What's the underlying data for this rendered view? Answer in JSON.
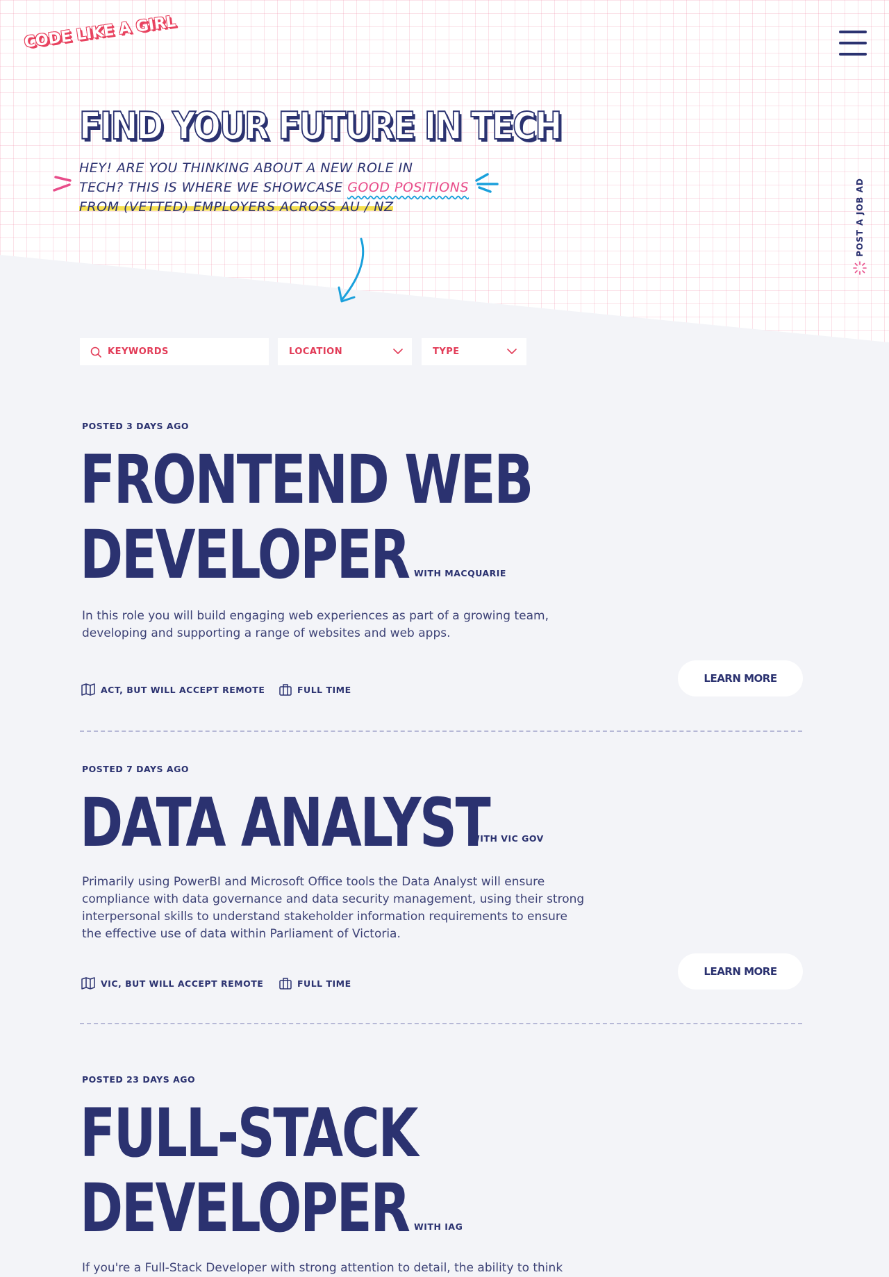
{
  "brand": {
    "logo_text": "CODE LIKE A GIRL"
  },
  "header": {
    "menu_icon": "hamburger-menu-icon",
    "post_ad_label": "POST A JOB AD"
  },
  "hero": {
    "title": "FIND YOUR FUTURE IN TECH",
    "subtitle_line1": "HEY! ARE YOU THINKING ABOUT A NEW ROLE IN",
    "subtitle_line2_a": "TECH? THIS IS WHERE WE SHOWCASE ",
    "subtitle_line2_highlight": "GOOD POSITIONS",
    "subtitle_line3": "FROM (VETTED) EMPLOYERS ACROSS AU / NZ"
  },
  "filters": {
    "keywords_placeholder": "KEYWORDS",
    "location_label": "LOCATION",
    "type_label": "TYPE"
  },
  "colors": {
    "navy": "#2b3270",
    "red": "#e23b57",
    "pink": "#e84d8a",
    "blue": "#1aa0dc",
    "yellow": "#f6e04f"
  },
  "jobs": [
    {
      "posted": "POSTED  3 DAYS AGO",
      "title_line1": "FRONTEND WEB",
      "title_line2": "DEVELOPER",
      "company": "WITH MACQUARIE",
      "description": "In this role you will build engaging web experiences as part of a growing team, developing and supporting a range of websites and web apps.",
      "location": "ACT, BUT WILL ACCEPT REMOTE",
      "type": "FULL TIME",
      "cta": "LEARN MORE"
    },
    {
      "posted": "POSTED  7 DAYS AGO",
      "title_line1": "DATA ANALYST",
      "company": "WITH VIC GOV",
      "description": "Primarily using PowerBI and Microsoft Office tools the Data Analyst will ensure compliance with data governance and data security management, using their strong interpersonal skills to understand stakeholder information requirements to ensure the effective use of data within Parliament of Victoria.",
      "location": "VIC, BUT WILL ACCEPT REMOTE",
      "type": "FULL TIME",
      "cta": "LEARN MORE"
    },
    {
      "posted": "POSTED  23 DAYS AGO",
      "title_line1": "FULL-STACK",
      "title_line2": "DEVELOPER",
      "company": "WITH IAG",
      "description": "If you're a Full-Stack Developer with strong attention to detail, the ability to think"
    }
  ]
}
